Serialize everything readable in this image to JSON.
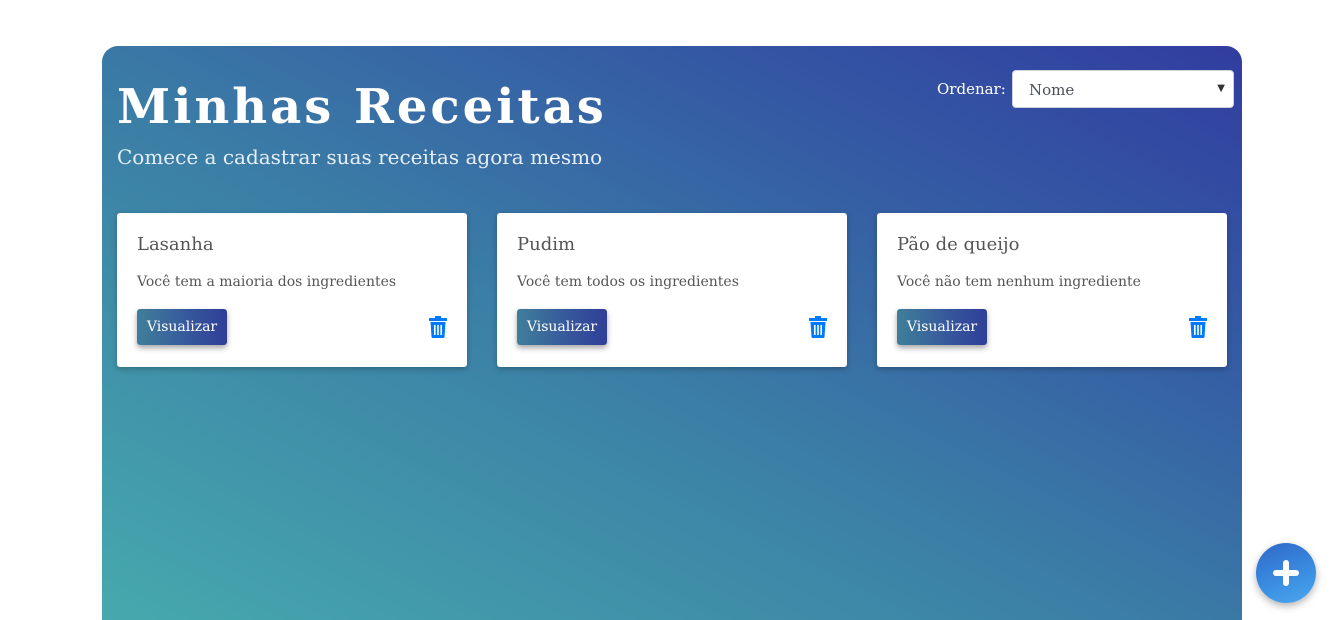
{
  "header": {
    "title": "Minhas Receitas",
    "subtitle": "Comece a cadastrar suas receitas agora mesmo"
  },
  "sort": {
    "label": "Ordenar:",
    "selected": "Nome"
  },
  "recipes": [
    {
      "name": "Lasanha",
      "status": "Você tem a maioria dos ingredientes",
      "view_label": "Visualizar",
      "delete_icon": "trash-icon"
    },
    {
      "name": "Pudim",
      "status": "Você tem todos os ingredientes",
      "view_label": "Visualizar",
      "delete_icon": "trash-icon"
    },
    {
      "name": "Pão de queijo",
      "status": "Você não tem nenhum ingrediente",
      "view_label": "Visualizar",
      "delete_icon": "trash-icon"
    }
  ],
  "fab": {
    "icon": "plus-icon"
  },
  "colors": {
    "accent": "#007bff",
    "gradient_start": "#46a9ad",
    "gradient_end": "#313d9f"
  }
}
